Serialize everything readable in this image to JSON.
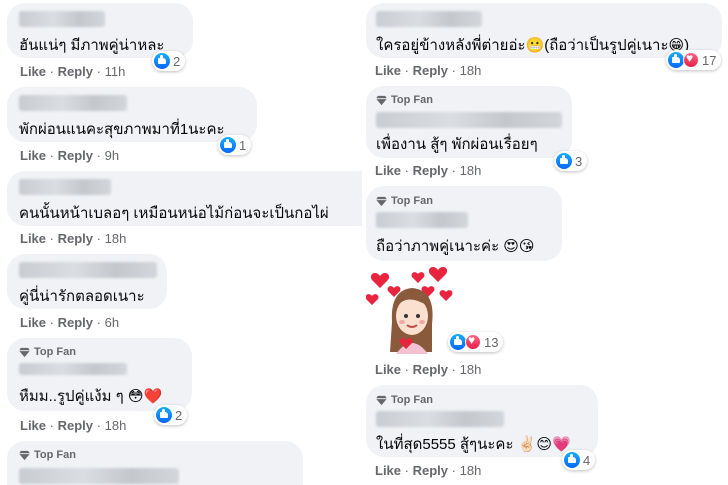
{
  "meta": {
    "like_label": "Like",
    "reply_label": "Reply",
    "separator": "·"
  },
  "badge": {
    "top_fan": "Top Fan"
  },
  "left_comments": [
    {
      "text": "ฮันแน่ๆ มีภาพคู่น่าหละ",
      "time": "11h",
      "reactions": "2"
    },
    {
      "text": "พักผ่อนแนคะสุขภาพมาที่1นะคะ",
      "time": "9h",
      "reactions": "1"
    },
    {
      "text": "คนนั้นหน้าเบลอๆ เหมือนหน่อไม้ก่อนจะเป็นกอไผ่",
      "time": "18h"
    },
    {
      "text": "คู่นี่น่ารักตลอดเนาะ",
      "time": "6h"
    },
    {
      "text": "หืมม..รูปคู่แง้ม ๆ",
      "emoji": "😳❤️",
      "time": "18h",
      "reactions": "2",
      "partial_name": "Pouna Thaaaaa"
    },
    {
      "text": ""
    }
  ],
  "right_comments": [
    {
      "text": "ใครอยู่ข้างหลังพี่ต่ายอ่ะ",
      "emoji_mid": "😬",
      "text2": "(ถือว่าเป็นรูปคู่เนาะ",
      "emoji_end": "😁)",
      "time": "18h",
      "reactions": "17"
    },
    {
      "text": "เพื่องาน สู้ๆ พักผ่อนเรื่อยๆ",
      "time": "18h",
      "reactions": "3"
    },
    {
      "text": "ถือว่าภาพคู่เนาะค่ะ",
      "emoji": "😍😘",
      "time": "18h"
    },
    {
      "sticker": "heart-girl-sticker",
      "time": "18h",
      "reactions": "13"
    },
    {
      "text": "ในที่สุด5555 สู้ๆนะคะ",
      "emoji": "✌🏻😊💗",
      "time": "18h",
      "reactions": "4"
    }
  ]
}
